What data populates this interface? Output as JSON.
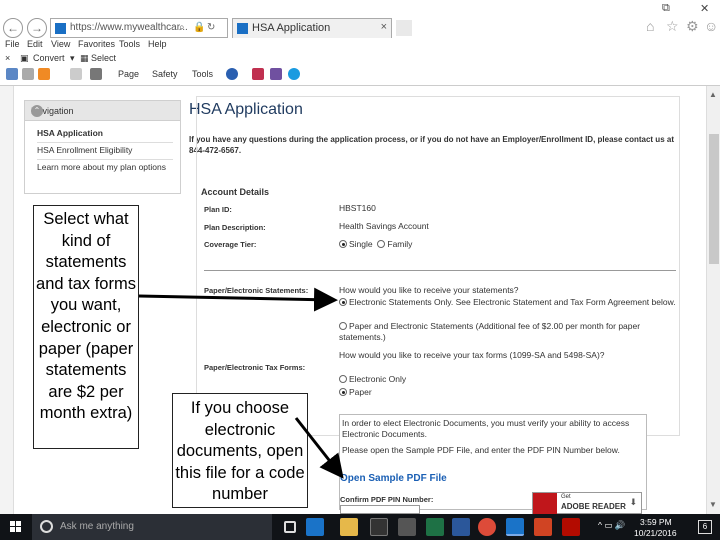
{
  "browser": {
    "address": {
      "url": "https://www.mywealthcar..."
    },
    "tab": {
      "title": "HSA Application",
      "close_glyph": "×"
    },
    "window_controls": [
      "⧉",
      "✕"
    ],
    "menu": [
      "File",
      "Edit",
      "View",
      "Favorites",
      "Tools",
      "Help"
    ],
    "favbar": {
      "close_glyph": "×",
      "convert": "Convert",
      "select": "Select"
    },
    "commandbar": {
      "page": "Page",
      "safety": "Safety",
      "tools": "Tools"
    }
  },
  "sidebar": {
    "title": "Navigation",
    "items": [
      {
        "label": "HSA Application",
        "active": true
      },
      {
        "label": "HSA Enrollment Eligibility",
        "active": false
      },
      {
        "label": "Learn more about my plan options",
        "active": false
      }
    ]
  },
  "main": {
    "title": "HSA Application",
    "intro": "If you have any questions during the application process, or if you do not have an Employer/Enrollment ID, please contact us at 844-472-6567.",
    "account_details": {
      "title": "Account Details",
      "plan_id": {
        "label": "Plan ID:",
        "value": "HBST160"
      },
      "plan_description": {
        "label": "Plan Description:",
        "value": "Health Savings Account"
      },
      "coverage_tier": {
        "label": "Coverage Tier:",
        "options": [
          "Single",
          "Family"
        ],
        "selected": "Single"
      }
    },
    "statements": {
      "label": "Paper/Electronic Statements:",
      "question": "How would you like to receive your statements?",
      "option_electronic": "Electronic Statements Only. See Electronic Statement and Tax Form Agreement below.",
      "option_paper": "Paper and Electronic Statements (Additional fee of $2.00 per month for paper statements.)"
    },
    "tax_forms": {
      "label": "Paper/Electronic Tax Forms:",
      "question": "How would you like to receive your tax forms (1099-SA and 5498-SA)?",
      "option_electronic": "Electronic Only",
      "option_paper": "Paper"
    },
    "edocs": {
      "text1": "In order to elect Electronic Documents, you must verify your ability to access Electronic Documents.",
      "text2": "Please open the Sample PDF File, and enter the PDF PIN Number below.",
      "open_link": "Open Sample PDF File",
      "pin_label": "Confirm PDF PIN Number:",
      "adobe_get": "Get",
      "adobe_reader": "ADOBE READER"
    }
  },
  "annotations": {
    "left": "Select what kind of statements and  tax forms you want, electronic or paper (paper statements are $2 per month extra)",
    "right": "If you choose electronic documents, open this file for a code number"
  },
  "taskbar": {
    "search_placeholder": "Ask me anything",
    "time": "3:59 PM",
    "date": "10/21/2016",
    "notifications": "6"
  },
  "colors": {
    "title_blue": "#1f3a5f",
    "link_blue": "#1a5fb4",
    "taskbar": "#101317",
    "adobe_red": "#c0161b"
  }
}
